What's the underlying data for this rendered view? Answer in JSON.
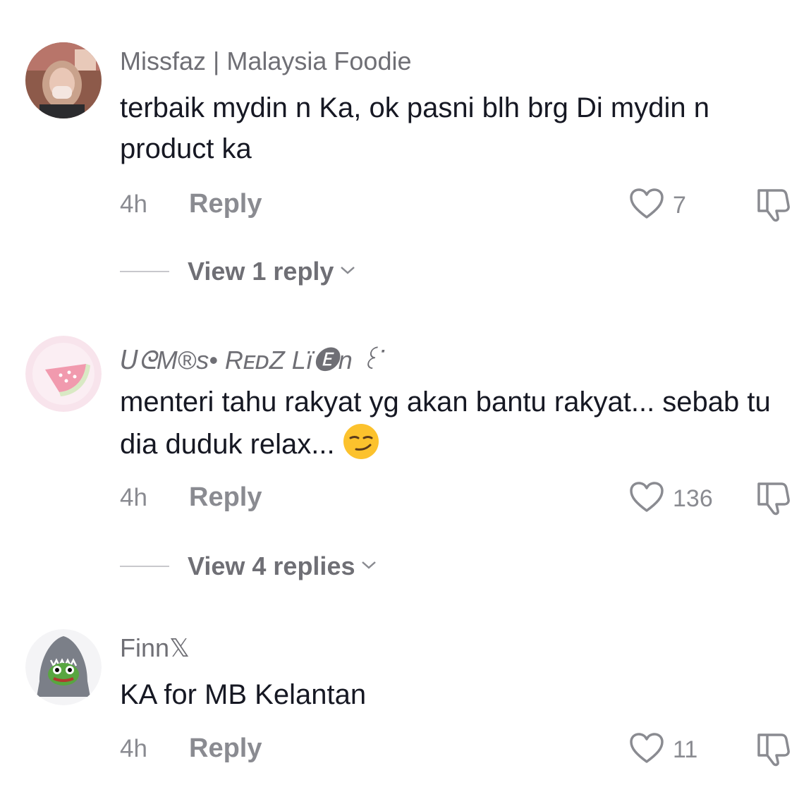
{
  "comments": [
    {
      "username": "Missfaz | Malaysia Foodie",
      "text": "terbaik mydin n Ka, ok pasni blh brg Di mydin n product ka",
      "time": "4h",
      "reply_label": "Reply",
      "likes": "7",
      "view_replies": "View 1 reply"
    },
    {
      "username": "ᑌᘓM®s• RᴇᴅZ Lï🅔n ꒰ᐝ",
      "text": "menteri tahu rakyat yg akan bantu rakyat... sebab tu dia duduk relax...",
      "emoji": "smirking-face",
      "time": "4h",
      "reply_label": "Reply",
      "likes": "136",
      "view_replies": "View 4 replies"
    },
    {
      "username": "Finn𝕏",
      "text": "KA for MB Kelantan",
      "time": "4h",
      "reply_label": "Reply",
      "likes": "11"
    }
  ],
  "colors": {
    "text": "#161823",
    "secondary": "#8a8b91",
    "username": "#6f6f75"
  }
}
